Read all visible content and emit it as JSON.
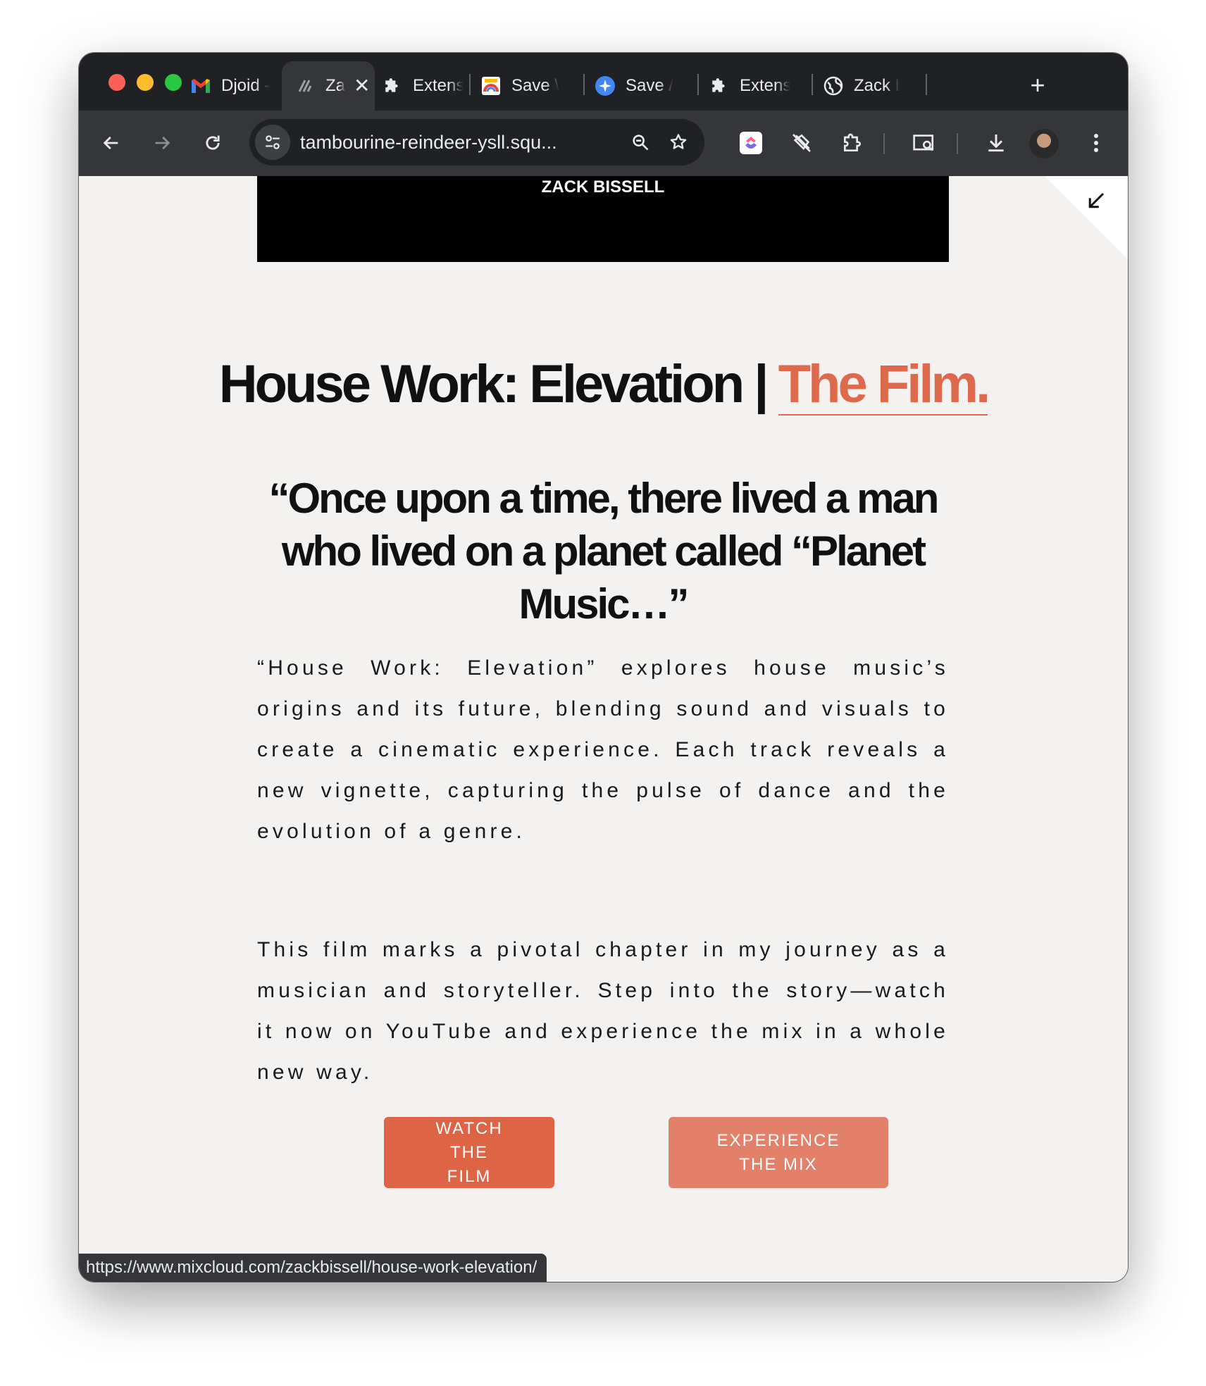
{
  "browser": {
    "tabs": [
      {
        "label": "Djoid -",
        "icon": "gmail-icon",
        "active": false
      },
      {
        "label": "Za",
        "icon": "squarespace-icon",
        "active": true
      },
      {
        "label": "Extens",
        "icon": "puzzle-icon",
        "active": false
      },
      {
        "label": "Save \\",
        "icon": "save-icon",
        "active": false
      },
      {
        "label": "Save /",
        "icon": "blue-star-icon",
        "active": false
      },
      {
        "label": "Extens",
        "icon": "puzzle-icon",
        "active": false
      },
      {
        "label": "Zack I",
        "icon": "globe-icon",
        "active": false
      }
    ],
    "new_tab_label": "+",
    "close_tab_glyph": "✕",
    "url": "tambourine-reindeer-ysll.squ...",
    "status_url": "https://www.mixcloud.com/zackbissell/house-work-elevation/"
  },
  "page": {
    "video_title": "ZACK BISSELL",
    "headline_main": "House Work: Elevation | ",
    "headline_accent": "The Film.",
    "quote": "“Once upon a time, there lived a man who lived on a planet called “Planet Music…”",
    "paragraph_1": "“House Work: Elevation” explores house music’s origins and its future, blending sound and visuals to create a cinematic experience. Each track reveals a new vignette, capturing the pulse of dance and the evolution of a genre.",
    "paragraph_2": "This film marks a pivotal chapter in my journey as a musician and storyteller. Step into the story—watch it now on YouTube and experience the mix in a whole new way.",
    "button_film": "WATCH THE FILM",
    "button_mix": "EXPERIENCE THE MIX"
  },
  "colors": {
    "accent": "#dd6a4d",
    "button_film": "#dd6445",
    "button_mix": "#e3806a",
    "page_bg": "#f3f2f0",
    "chrome_dark": "#202124",
    "chrome_toolbar": "#35363a"
  }
}
